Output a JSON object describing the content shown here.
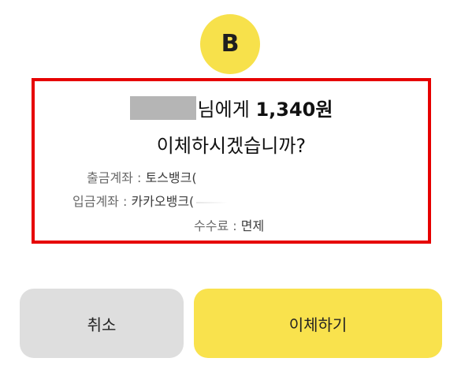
{
  "logo": {
    "letter": "B",
    "color": "#f7e14b"
  },
  "dialog": {
    "border_color": "#e60000",
    "recipient_suffix": "님에게",
    "amount": "1,340원",
    "question": "이체하시겠습니까?",
    "withdraw_label": "출금계좌",
    "withdraw_value": "토스뱅크(",
    "deposit_label": "입금계좌",
    "deposit_value": "카카오뱅크(",
    "fee_label": "수수료",
    "fee_value": "면제",
    "separator": " : "
  },
  "buttons": {
    "cancel_label": "취소",
    "confirm_label": "이체하기",
    "cancel_color": "#dedede",
    "confirm_color": "#f9e24d"
  }
}
